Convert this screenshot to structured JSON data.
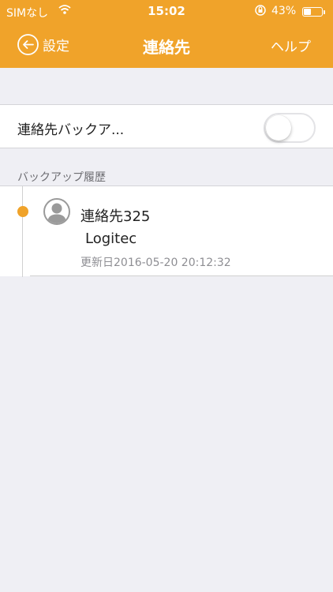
{
  "status_bar": {
    "carrier": "SIMなし",
    "time": "15:02",
    "battery_percent": "43%",
    "battery_level": 0.43
  },
  "nav": {
    "back_label": "設定",
    "title": "連絡先",
    "help_label": "ヘルプ"
  },
  "backup_toggle": {
    "label": "連絡先バックア...",
    "enabled": false
  },
  "history": {
    "section_title": "バックアップ履歴",
    "entries": [
      {
        "name": "連絡先325",
        "device": "Logitec",
        "updated": "更新日2016-05-20 20:12:32"
      }
    ]
  },
  "colors": {
    "accent": "#f0a32a",
    "background": "#efeff4"
  }
}
